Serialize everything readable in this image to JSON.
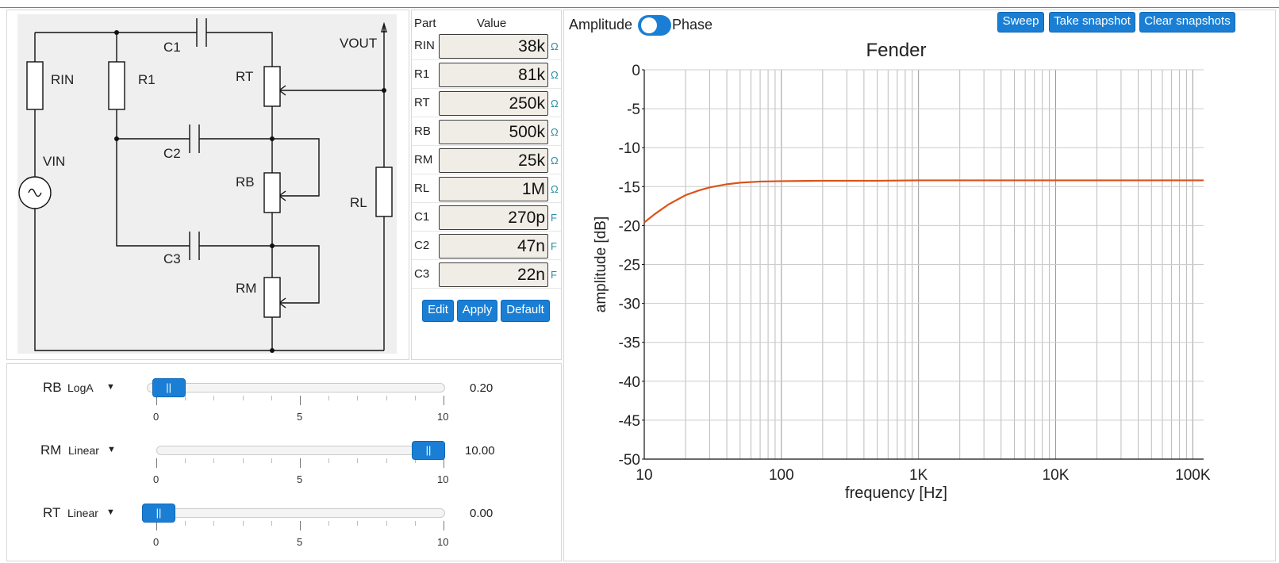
{
  "schematic": {
    "labels": {
      "rin": "RIN",
      "r1": "R1",
      "c1": "C1",
      "rt": "RT",
      "vout": "VOUT",
      "c2": "C2",
      "rb": "RB",
      "vin": "VIN",
      "rl": "RL",
      "c3": "C3",
      "rm": "RM"
    }
  },
  "parts": {
    "header_part": "Part",
    "header_value": "Value",
    "rows": [
      {
        "name": "RIN",
        "value": "38k",
        "unit": "Ω"
      },
      {
        "name": "R1",
        "value": "81k",
        "unit": "Ω"
      },
      {
        "name": "RT",
        "value": "250k",
        "unit": "Ω"
      },
      {
        "name": "RB",
        "value": "500k",
        "unit": "Ω"
      },
      {
        "name": "RM",
        "value": "25k",
        "unit": "Ω"
      },
      {
        "name": "RL",
        "value": "1M",
        "unit": "Ω"
      },
      {
        "name": "C1",
        "value": "270p",
        "unit": "F"
      },
      {
        "name": "C2",
        "value": "47n",
        "unit": "F"
      },
      {
        "name": "C3",
        "value": "22n",
        "unit": "F"
      }
    ],
    "buttons": {
      "edit": "Edit",
      "apply": "Apply",
      "default": "Default"
    }
  },
  "sliders": [
    {
      "name": "RB",
      "taper": "LogA",
      "value": "0.20",
      "level": 0.02,
      "thumb_label": "||",
      "tick_labels": [
        "0",
        "5",
        "10"
      ]
    },
    {
      "name": "RM",
      "taper": "Linear",
      "value": "10.00",
      "level": 1.0,
      "thumb_label": "||",
      "tick_labels": [
        "0",
        "5",
        "10"
      ]
    },
    {
      "name": "RT",
      "taper": "Linear",
      "value": "0.00",
      "level": 0.0,
      "thumb_label": "||",
      "tick_labels": [
        "0",
        "5",
        "10"
      ]
    }
  ],
  "plot_header": {
    "amplitude_label": "Amplitude",
    "phase_label": "Phase",
    "sweep": "Sweep",
    "take_snapshot": "Take snapshot",
    "clear_snapshots": "Clear snapshots"
  },
  "chart_data": {
    "type": "line",
    "title": "Fender",
    "xlabel": "frequency [Hz]",
    "ylabel": "amplitude [dB]",
    "xscale": "log",
    "xlim": [
      10,
      120000
    ],
    "ylim": [
      -50,
      0
    ],
    "x_tick_labels": [
      "10",
      "100",
      "1K",
      "10K",
      "100K"
    ],
    "y_tick_labels": [
      "0",
      "-5",
      "-10",
      "-15",
      "-20",
      "-25",
      "-30",
      "-35",
      "-40",
      "-45",
      "-50"
    ],
    "grid": true,
    "line_color": "#d95319",
    "series": [
      {
        "x": [
          10,
          12,
          15,
          20,
          25,
          30,
          40,
          50,
          70,
          100,
          200,
          500,
          1000,
          2000,
          5000,
          10000,
          50000,
          120000
        ],
        "values": [
          -19.6,
          -18.5,
          -17.3,
          -16.1,
          -15.5,
          -15.1,
          -14.7,
          -14.5,
          -14.35,
          -14.3,
          -14.25,
          -14.25,
          -14.2,
          -14.2,
          -14.2,
          -14.2,
          -14.2,
          -14.2
        ]
      }
    ]
  }
}
